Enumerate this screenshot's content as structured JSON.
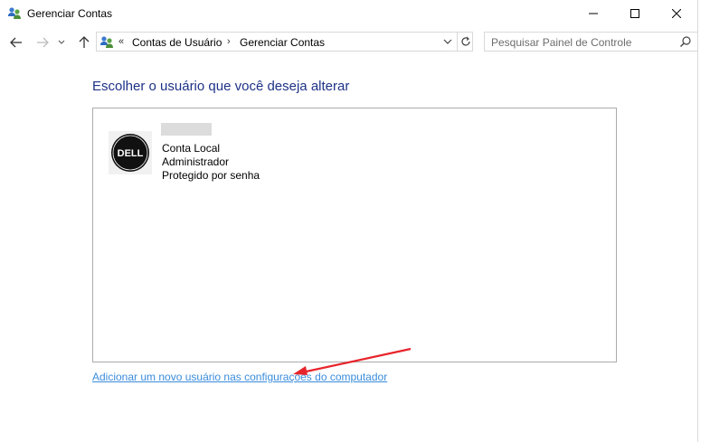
{
  "window": {
    "title": "Gerenciar Contas"
  },
  "address_bar": {
    "overflow_chevron": "«",
    "breadcrumbs": [
      "Contas de Usuário",
      "Gerenciar Contas"
    ],
    "separator": "›"
  },
  "search": {
    "placeholder": "Pesquisar Painel de Controle"
  },
  "main": {
    "heading": "Escolher o usuário que você deseja alterar",
    "accounts": [
      {
        "avatar_logo": "DELL",
        "name_visible": "",
        "type": "Conta Local",
        "role": "Administrador",
        "protection": "Protegido por senha"
      }
    ],
    "add_user_link": "Adicionar um novo usuário nas configurações do computador"
  },
  "colors": {
    "heading": "#1e3287",
    "link": "#3a8cdc",
    "annotation_arrow": "#e8242b",
    "panel_border": "#ababab"
  },
  "icons": [
    "users-icon",
    "minimize-icon",
    "maximize-icon",
    "close-icon",
    "back-arrow-icon",
    "forward-arrow-icon",
    "recent-dropdown-icon",
    "up-arrow-icon",
    "chevron-down-icon",
    "refresh-icon",
    "search-icon",
    "dell-avatar-icon",
    "red-arrow-annotation-icon"
  ]
}
